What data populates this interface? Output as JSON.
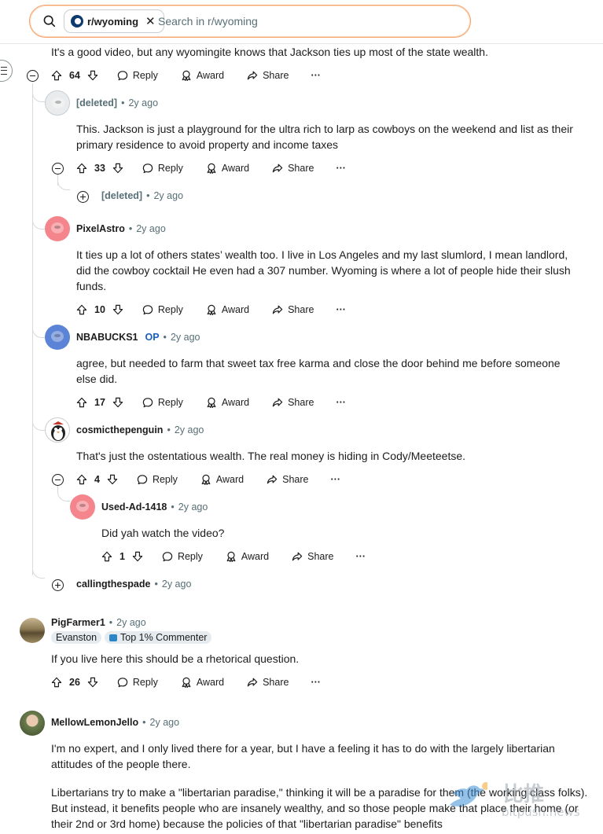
{
  "search": {
    "chip_label": "r/wyoming",
    "placeholder": "Search in r/wyoming"
  },
  "comments": [
    {
      "id": "c1",
      "body": "It's a good video, but any wyomingite knows that Jackson ties up most of the state wealth.",
      "votes": "64"
    },
    {
      "id": "c2",
      "author": "[deleted]",
      "time": "2y ago",
      "body": "This. Jackson is just a playground for the ultra rich to larp as cowboys on the weekend and list as their primary residence to avoid property and income taxes",
      "votes": "33"
    },
    {
      "id": "c3",
      "author": "[deleted]",
      "time": "2y ago",
      "collapsed": true
    },
    {
      "id": "c4",
      "author": "PixelAstro",
      "time": "2y ago",
      "body": "It ties up a lot of others states’ wealth too. I live in Los Angeles and my last slumlord, I mean landlord, did the cowboy cocktail He even had a 307 number. Wyoming is where a lot of people hide their slush funds.",
      "votes": "10"
    },
    {
      "id": "c5",
      "author": "NBABUCKS1",
      "badge": "OP",
      "time": "2y ago",
      "body": "agree, but needed to farm that sweet tax free karma and close the door behind me before someone else did.",
      "votes": "17"
    },
    {
      "id": "c6",
      "author": "cosmicthepenguin",
      "time": "2y ago",
      "body": "That's just the ostentatious wealth. The real money is hiding in Cody/Meeteetse.",
      "votes": "4"
    },
    {
      "id": "c7",
      "author": "Used-Ad-1418",
      "time": "2y ago",
      "body": "Did yah watch the video?",
      "votes": "1"
    },
    {
      "id": "c8",
      "author": "callingthespade",
      "time": "2y ago",
      "collapsed": true
    },
    {
      "id": "c9",
      "author": "PigFarmer1",
      "time": "2y ago",
      "flair_location": "Evanston",
      "flair_commenter": "Top 1% Commenter",
      "body": "If you live here this should be a rhetorical question.",
      "votes": "26"
    },
    {
      "id": "c10",
      "author": "MellowLemonJello",
      "time": "2y ago",
      "body": "I'm no expert, and I only lived there for a year, but I have a feeling it has to do with the largely libertarian attitudes of the people there.",
      "body2": "Libertarians try to make a \"libertarian paradise,\" thinking it will be a paradise for them (the working class folks). But instead, it benefits people who are insanely wealthy, and so those people make that place their home (or their 2nd or 3rd home) because the policies of that \"libertarian paradise\" benefits"
    }
  ],
  "actions": {
    "reply": "Reply",
    "award": "Award",
    "share": "Share",
    "more": "···",
    "dot": "•"
  },
  "watermark": {
    "chinese": "比推",
    "domain": "bitpush.news"
  },
  "icons": [
    "search-icon",
    "close-icon",
    "upvote-icon",
    "downvote-icon",
    "reply-icon",
    "award-icon",
    "share-icon",
    "more-icon",
    "collapse-icon",
    "expand-icon",
    "sidebar-toggle-icon"
  ],
  "colors": {
    "search_border": "#f5a16a",
    "thread_line": "#d7dadc",
    "meta_text": "#576f76",
    "op_badge": "#1a5fbf",
    "flair_bg": "#e5ebee"
  }
}
